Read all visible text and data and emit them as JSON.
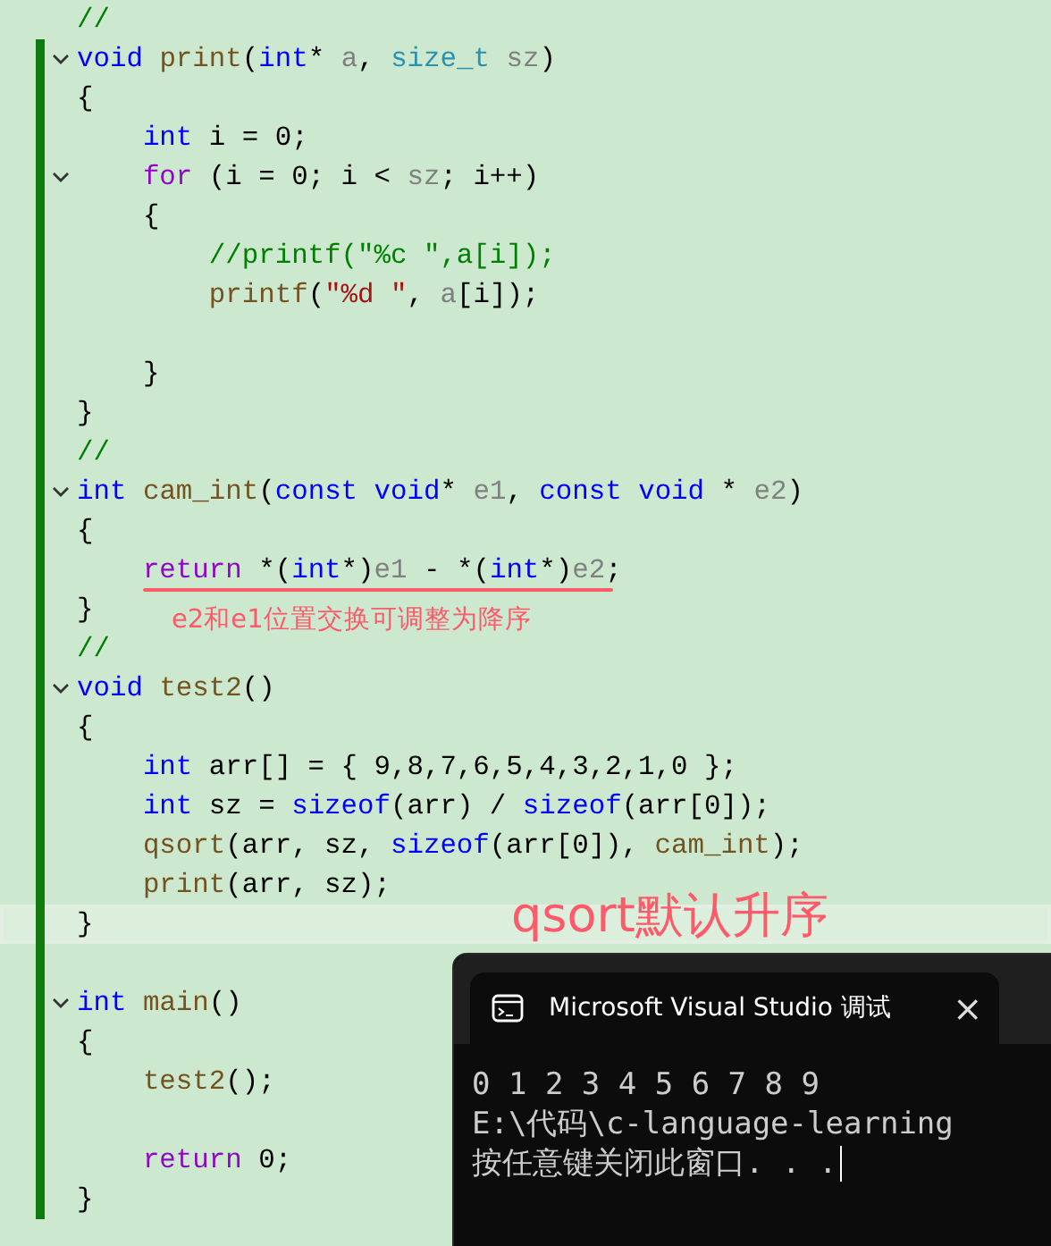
{
  "editor": {
    "lines": [
      {
        "tokens": [
          {
            "text": "//",
            "kind": "comment"
          }
        ],
        "fold": false,
        "modified": false,
        "current": false
      },
      {
        "tokens": [
          {
            "text": "void ",
            "kind": "keyword"
          },
          {
            "text": "print",
            "kind": "func"
          },
          {
            "text": "(",
            "kind": "plain"
          },
          {
            "text": "int",
            "kind": "keyword"
          },
          {
            "text": "* ",
            "kind": "plain"
          },
          {
            "text": "a",
            "kind": "param"
          },
          {
            "text": ", ",
            "kind": "plain"
          },
          {
            "text": "size_t ",
            "kind": "type"
          },
          {
            "text": "sz",
            "kind": "param"
          },
          {
            "text": ")",
            "kind": "plain"
          }
        ],
        "fold": true,
        "modified": true,
        "current": false
      },
      {
        "tokens": [
          {
            "text": "{",
            "kind": "plain"
          }
        ],
        "fold": false,
        "modified": true,
        "current": false
      },
      {
        "tokens": [
          {
            "text": "    int",
            "kind": "keyword"
          },
          {
            "text": " i = 0;",
            "kind": "plain"
          }
        ],
        "fold": false,
        "modified": true,
        "current": false
      },
      {
        "tokens": [
          {
            "text": "    for",
            "kind": "control"
          },
          {
            "text": " (i = 0; i < ",
            "kind": "plain"
          },
          {
            "text": "sz",
            "kind": "param"
          },
          {
            "text": "; i++)",
            "kind": "plain"
          }
        ],
        "fold": true,
        "modified": true,
        "current": false
      },
      {
        "tokens": [
          {
            "text": "    {",
            "kind": "plain"
          }
        ],
        "fold": false,
        "modified": true,
        "current": false
      },
      {
        "tokens": [
          {
            "text": "        //printf(\"%c \",a[i]);",
            "kind": "comment"
          }
        ],
        "fold": false,
        "modified": true,
        "current": false
      },
      {
        "tokens": [
          {
            "text": "        printf",
            "kind": "func"
          },
          {
            "text": "(",
            "kind": "plain"
          },
          {
            "text": "\"%d \"",
            "kind": "string"
          },
          {
            "text": ", ",
            "kind": "plain"
          },
          {
            "text": "a",
            "kind": "param"
          },
          {
            "text": "[i]);",
            "kind": "plain"
          }
        ],
        "fold": false,
        "modified": true,
        "current": false
      },
      {
        "fold": false,
        "modified": true,
        "current": false
      },
      {
        "tokens": [
          {
            "text": "    }",
            "kind": "plain"
          }
        ],
        "fold": false,
        "modified": true,
        "current": false
      },
      {
        "tokens": [
          {
            "text": "}",
            "kind": "plain"
          }
        ],
        "fold": false,
        "modified": true,
        "current": false
      },
      {
        "tokens": [
          {
            "text": "//",
            "kind": "comment"
          }
        ],
        "fold": false,
        "modified": true,
        "current": false
      },
      {
        "tokens": [
          {
            "text": "int ",
            "kind": "keyword"
          },
          {
            "text": "cam_int",
            "kind": "func"
          },
          {
            "text": "(",
            "kind": "plain"
          },
          {
            "text": "const void",
            "kind": "keyword"
          },
          {
            "text": "* ",
            "kind": "plain"
          },
          {
            "text": "e1",
            "kind": "param"
          },
          {
            "text": ", ",
            "kind": "plain"
          },
          {
            "text": "const void",
            "kind": "keyword"
          },
          {
            "text": " * ",
            "kind": "plain"
          },
          {
            "text": "e2",
            "kind": "param"
          },
          {
            "text": ")",
            "kind": "plain"
          }
        ],
        "fold": true,
        "modified": true,
        "current": false
      },
      {
        "tokens": [
          {
            "text": "{",
            "kind": "plain"
          }
        ],
        "fold": false,
        "modified": true,
        "current": false
      },
      {
        "tokens": [
          {
            "text": "    return",
            "kind": "control"
          },
          {
            "text": " *(",
            "kind": "plain"
          },
          {
            "text": "int",
            "kind": "keyword"
          },
          {
            "text": "*)",
            "kind": "plain"
          },
          {
            "text": "e1",
            "kind": "param"
          },
          {
            "text": " - *(",
            "kind": "plain"
          },
          {
            "text": "int",
            "kind": "keyword"
          },
          {
            "text": "*)",
            "kind": "plain"
          },
          {
            "text": "e2",
            "kind": "param"
          },
          {
            "text": ";",
            "kind": "plain"
          }
        ],
        "fold": false,
        "modified": true,
        "current": false
      },
      {
        "tokens": [
          {
            "text": "}",
            "kind": "plain"
          }
        ],
        "fold": false,
        "modified": true,
        "current": false
      },
      {
        "tokens": [
          {
            "text": "//",
            "kind": "comment"
          }
        ],
        "fold": false,
        "modified": true,
        "current": false
      },
      {
        "tokens": [
          {
            "text": "void ",
            "kind": "keyword"
          },
          {
            "text": "test2",
            "kind": "func"
          },
          {
            "text": "()",
            "kind": "plain"
          }
        ],
        "fold": true,
        "modified": true,
        "current": false
      },
      {
        "tokens": [
          {
            "text": "{",
            "kind": "plain"
          }
        ],
        "fold": false,
        "modified": true,
        "current": false
      },
      {
        "tokens": [
          {
            "text": "    int",
            "kind": "keyword"
          },
          {
            "text": " arr[] = { 9,8,7,6,5,4,3,2,1,0 };",
            "kind": "plain"
          }
        ],
        "fold": false,
        "modified": true,
        "current": false
      },
      {
        "tokens": [
          {
            "text": "    int",
            "kind": "keyword"
          },
          {
            "text": " sz = ",
            "kind": "plain"
          },
          {
            "text": "sizeof",
            "kind": "keyword"
          },
          {
            "text": "(arr) / ",
            "kind": "plain"
          },
          {
            "text": "sizeof",
            "kind": "keyword"
          },
          {
            "text": "(arr[0]);",
            "kind": "plain"
          }
        ],
        "fold": false,
        "modified": true,
        "current": false
      },
      {
        "tokens": [
          {
            "text": "    qsort",
            "kind": "func"
          },
          {
            "text": "(arr, sz, ",
            "kind": "plain"
          },
          {
            "text": "sizeof",
            "kind": "keyword"
          },
          {
            "text": "(arr[0]), ",
            "kind": "plain"
          },
          {
            "text": "cam_int",
            "kind": "func"
          },
          {
            "text": ");",
            "kind": "plain"
          }
        ],
        "fold": false,
        "modified": true,
        "current": false
      },
      {
        "tokens": [
          {
            "text": "    print",
            "kind": "func"
          },
          {
            "text": "(arr, sz);",
            "kind": "plain"
          }
        ],
        "fold": false,
        "modified": true,
        "current": false
      },
      {
        "tokens": [
          {
            "text": "}",
            "kind": "plain"
          }
        ],
        "fold": false,
        "modified": true,
        "current": true
      },
      {
        "fold": false,
        "modified": true,
        "current": false
      },
      {
        "tokens": [
          {
            "text": "int ",
            "kind": "keyword"
          },
          {
            "text": "main",
            "kind": "func"
          },
          {
            "text": "()",
            "kind": "plain"
          }
        ],
        "fold": true,
        "modified": true,
        "current": false
      },
      {
        "tokens": [
          {
            "text": "{",
            "kind": "plain"
          }
        ],
        "fold": false,
        "modified": true,
        "current": false
      },
      {
        "tokens": [
          {
            "text": "    test2",
            "kind": "func"
          },
          {
            "text": "();",
            "kind": "plain"
          }
        ],
        "fold": false,
        "modified": true,
        "current": false
      },
      {
        "fold": false,
        "modified": true,
        "current": false
      },
      {
        "tokens": [
          {
            "text": "    return",
            "kind": "control"
          },
          {
            "text": " 0;",
            "kind": "plain"
          }
        ],
        "fold": false,
        "modified": true,
        "current": false
      },
      {
        "tokens": [
          {
            "text": "}",
            "kind": "plain"
          }
        ],
        "fold": false,
        "modified": true,
        "current": false
      }
    ]
  },
  "annotations": [
    {
      "text": "e2和e1位置交换可调整为降序",
      "kind": "note"
    },
    {
      "text": "qsort默认升序",
      "kind": "headline"
    }
  ],
  "console": {
    "tab_title": "Microsoft Visual Studio 调试",
    "close": "×",
    "output": [
      "0 1 2 3 4 5 6 7 8 9",
      "E:\\代码\\c-language-learning",
      "按任意键关闭此窗口. . ."
    ]
  }
}
